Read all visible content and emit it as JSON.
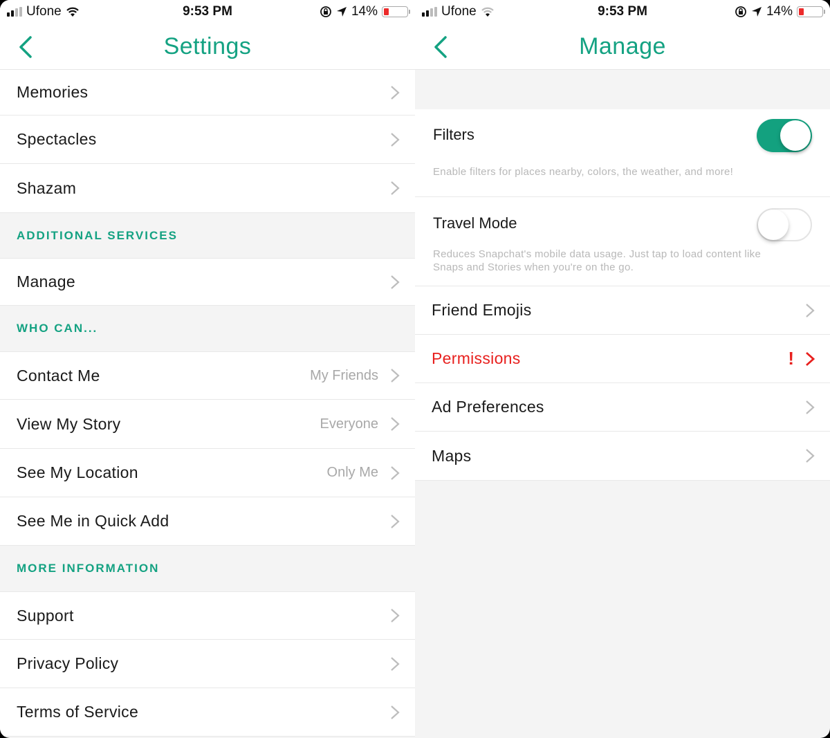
{
  "status_bar": {
    "carrier": "Ufone",
    "time": "9:53 PM",
    "battery": "14%",
    "battery_level": 0.14,
    "signal_bars_active": 2,
    "signal_bars_total": 4
  },
  "colors": {
    "accent": "#14a282",
    "alert": "#e8201e",
    "secondary_text": "#a8a8a8"
  },
  "settings_screen": {
    "title": "Settings",
    "back_icon": "chevron-left-icon",
    "top_items": [
      {
        "label": "Memories"
      },
      {
        "label": "Spectacles"
      },
      {
        "label": "Shazam"
      }
    ],
    "sections": [
      {
        "header": "ADDITIONAL SERVICES",
        "items": [
          {
            "label": "Manage",
            "value": ""
          }
        ]
      },
      {
        "header": "WHO CAN...",
        "items": [
          {
            "label": "Contact Me",
            "value": "My Friends"
          },
          {
            "label": "View My Story",
            "value": "Everyone"
          },
          {
            "label": "See My Location",
            "value": "Only Me"
          },
          {
            "label": "See Me in Quick Add",
            "value": ""
          }
        ]
      },
      {
        "header": "MORE INFORMATION",
        "items": [
          {
            "label": "Support",
            "value": ""
          },
          {
            "label": "Privacy Policy",
            "value": ""
          },
          {
            "label": "Terms of Service",
            "value": ""
          }
        ]
      }
    ]
  },
  "manage_screen": {
    "title": "Manage",
    "back_icon": "chevron-left-icon",
    "toggles": [
      {
        "label": "Filters",
        "description": "Enable filters for places nearby, colors, the weather, and more!",
        "on": true
      },
      {
        "label": "Travel Mode",
        "description": "Reduces Snapchat's mobile data usage. Just tap to load content like Snaps and Stories when you're on the go.",
        "on": false
      }
    ],
    "items": [
      {
        "label": "Friend Emojis",
        "alert": false
      },
      {
        "label": "Permissions",
        "alert": true,
        "alert_symbol": "!"
      },
      {
        "label": "Ad Preferences",
        "alert": false
      },
      {
        "label": "Maps",
        "alert": false
      }
    ]
  }
}
